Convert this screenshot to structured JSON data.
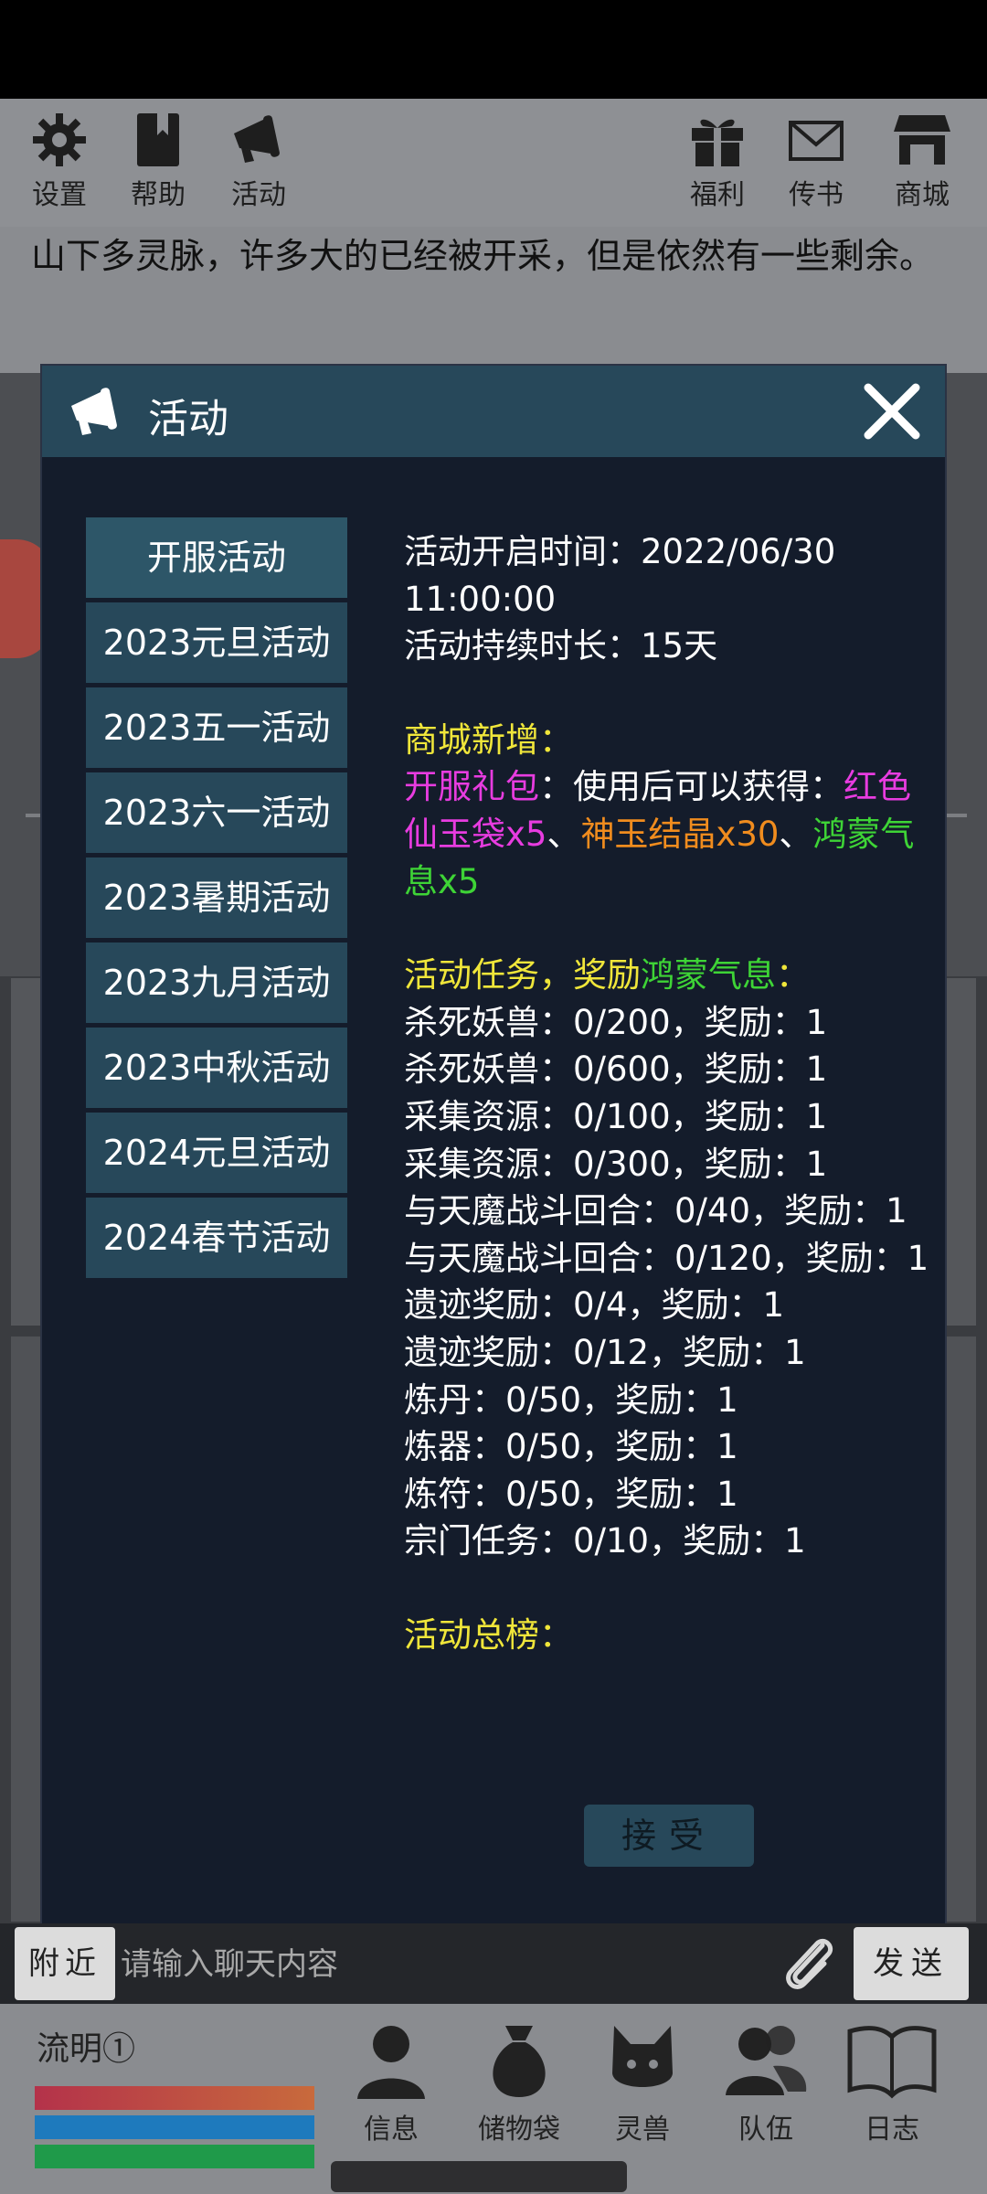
{
  "topbar": {
    "left": [
      {
        "label": "设置",
        "icon": "gear-icon"
      },
      {
        "label": "帮助",
        "icon": "book-icon"
      },
      {
        "label": "活动",
        "icon": "megaphone-icon"
      }
    ],
    "right": [
      {
        "label": "福利",
        "icon": "gift-icon"
      },
      {
        "label": "传书",
        "icon": "mail-icon"
      },
      {
        "label": "商城",
        "icon": "shop-icon"
      }
    ]
  },
  "narration": "山下多灵脉，许多大的已经被开采，但是依然有一些剩余。",
  "modal": {
    "title": "活动",
    "tabs": [
      "开服活动",
      "2023元旦活动",
      "2023五一活动",
      "2023六一活动",
      "2023暑期活动",
      "2023九月活动",
      "2023中秋活动",
      "2024元旦活动",
      "2024春节活动"
    ],
    "content": {
      "start_time": "活动开启时间：2022/06/30 11:00:00",
      "duration": "活动持续时长：15天",
      "shop_heading": "商城新增：",
      "pack_name": "开服礼包",
      "pack_desc": "：使用后可以获得：",
      "item1": "红色仙玉袋x5",
      "sep1": "、",
      "item2": "神玉结晶x30",
      "sep2": "、",
      "item3": "鸿蒙气息x5",
      "task_heading_a": "活动任务，奖励",
      "task_heading_b": "鸿蒙气息",
      "task_heading_c": "：",
      "tasks": [
        "杀死妖兽：0/200，奖励：1",
        "杀死妖兽：0/600，奖励：1",
        "采集资源：0/100，奖励：1",
        "采集资源：0/300，奖励：1",
        "与天魔战斗回合：0/40，奖励：1",
        "与天魔战斗回合：0/120，奖励：1",
        "遗迹奖励：0/4，奖励：1",
        "遗迹奖励：0/12，奖励：1",
        "炼丹：0/50，奖励：1",
        "炼器：0/50，奖励：1",
        "炼符：0/50，奖励：1",
        "宗门任务：0/10，奖励：1"
      ],
      "summary_heading": "活动总榜："
    },
    "accept_label": "接受"
  },
  "chat": {
    "channel_label": "附近",
    "placeholder": "请输入聊天内容",
    "send_label": "发送"
  },
  "bottom": {
    "character_name": "流明①",
    "bar_colors": [
      "#b4324a",
      "#1e7abd",
      "#1f9a4a"
    ],
    "nav": [
      {
        "label": "信息",
        "icon": "person-icon"
      },
      {
        "label": "储物袋",
        "icon": "pouch-icon"
      },
      {
        "label": "灵兽",
        "icon": "cat-icon"
      },
      {
        "label": "队伍",
        "icon": "team-icon"
      },
      {
        "label": "日志",
        "icon": "open-book-icon"
      }
    ]
  }
}
